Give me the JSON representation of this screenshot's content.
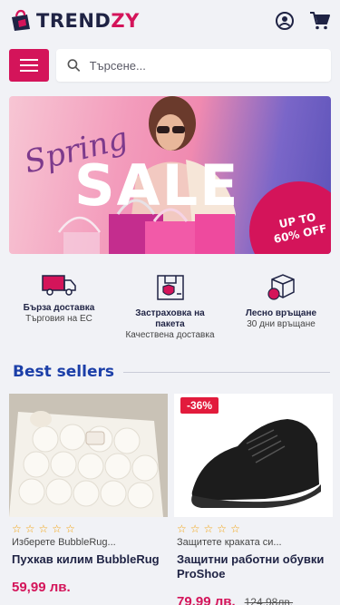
{
  "brand": {
    "name_part1": "TREND",
    "name_part2": "ZY",
    "accent_color": "#d4145a",
    "dark_color": "#1f2344"
  },
  "header": {
    "account_icon": "account-circle-icon",
    "cart_icon": "cart-icon"
  },
  "search": {
    "placeholder": "Търсене...",
    "menu_icon": "hamburger-menu-icon",
    "search_icon": "search-icon"
  },
  "banner": {
    "script_text": "Spring",
    "headline": "SALE",
    "badge_line1": "UP TO",
    "badge_line2": "60% OFF"
  },
  "features": [
    {
      "icon": "delivery-truck-icon",
      "title": "Бърза доставка",
      "subtitle": "Търговия на ЕС"
    },
    {
      "icon": "package-shield-icon",
      "title": "Застраховка на пакета",
      "subtitle": "Качествена доставка"
    },
    {
      "icon": "return-box-icon",
      "title": "Лесно връщане",
      "subtitle": "30 дни връщане"
    }
  ],
  "best_sellers": {
    "title": "Best sellers",
    "products": [
      {
        "sale_tag": "",
        "rating": 0,
        "subtitle": "Изберете BubbleRug...",
        "name": "Пухкав килим BubbleRug",
        "price": "59,99 лв.",
        "old_price": ""
      },
      {
        "sale_tag": "-36%",
        "rating": 0,
        "subtitle": "Защитете краката си...",
        "name": "Защитни работни обувки ProShoe",
        "price": "79,99 лв.",
        "old_price": "124,98лв."
      }
    ]
  }
}
